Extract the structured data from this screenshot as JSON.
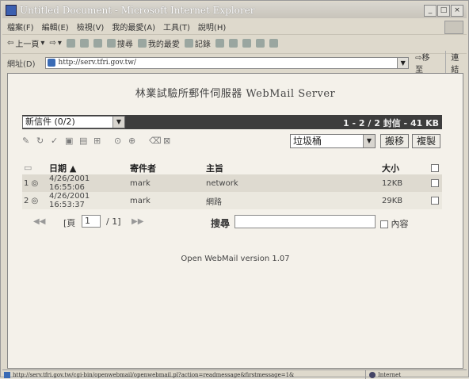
{
  "window": {
    "title": "Untitled Document - Microsoft Internet Explorer",
    "controls": [
      "_",
      "□",
      "×"
    ]
  },
  "menu": [
    "檔案(F)",
    "編輯(E)",
    "檢視(V)",
    "我的最愛(A)",
    "工具(T)",
    "說明(H)"
  ],
  "toolbar": {
    "back": "上一頁",
    "search": "搜尋",
    "favorites": "我的最愛",
    "history": "記錄"
  },
  "addressbar": {
    "label": "網址(D)",
    "url": "http://serv.tfri.gov.tw/",
    "go": "移至",
    "links": "連結"
  },
  "page": {
    "server_title": "林業試驗所郵件伺服器 WebMail Server",
    "folder": "新信件 (0/2)",
    "message_count": "1 - 2 / 2 封信 - 41 KB",
    "trash_folder": "垃圾桶",
    "move_btn": "搬移",
    "copy_btn": "複製",
    "columns": {
      "date": "日期 ▲",
      "sender": "寄件者",
      "subject": "主旨",
      "size": "大小"
    },
    "messages": [
      {
        "num": "1",
        "date": "4/26/2001 16:55:06",
        "sender": "mark",
        "subject": "network",
        "size": "12KB"
      },
      {
        "num": "2",
        "date": "4/26/2001 16:53:37",
        "sender": "mark",
        "subject": "網路",
        "size": "29KB"
      }
    ],
    "pager": {
      "prefix": "[頁",
      "page": "1",
      "suffix": "/ 1]"
    },
    "search_label": "搜尋",
    "content_label": "內容",
    "version": "Open WebMail version 1.07"
  },
  "status": {
    "text": "http://serv.tfri.gov.tw/cgi-bin/openwebmail/openwebmail.pl?action=readmessage&firstmessage=1&",
    "zone": "Internet"
  }
}
